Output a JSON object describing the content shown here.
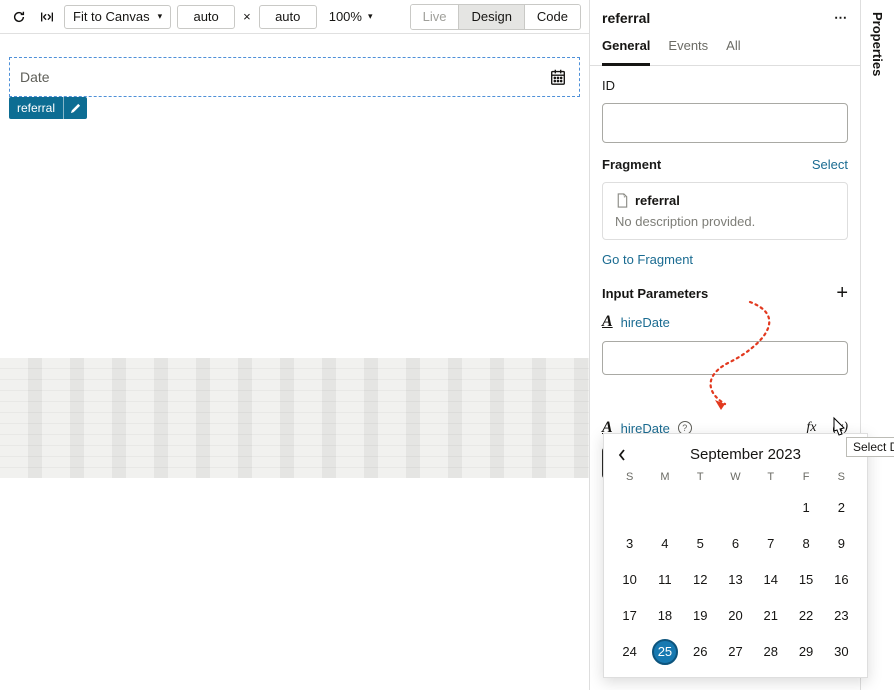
{
  "toolbar": {
    "fit_label": "Fit to Canvas",
    "width": "auto",
    "height": "auto",
    "zoom": "100%",
    "live": "Live",
    "design": "Design",
    "code": "Code"
  },
  "canvas": {
    "placeholder": "Date",
    "badge": "referral"
  },
  "panel": {
    "title": "referral",
    "tabs": {
      "general": "General",
      "events": "Events",
      "all": "All"
    },
    "id_label": "ID",
    "id_value": "",
    "fragment_label": "Fragment",
    "select_link": "Select",
    "fragment_name": "referral",
    "fragment_desc": "No description provided.",
    "go_link": "Go to Fragment",
    "input_params_label": "Input Parameters",
    "param1": "hireDate",
    "param1_value": "",
    "param2": "hireDate",
    "fx_label": "fx",
    "x_var": "(x)",
    "date_placeholder": "Select a date",
    "vertical_tab": "Properties"
  },
  "calendar": {
    "month_label": "September 2023",
    "dow": [
      "S",
      "M",
      "T",
      "W",
      "T",
      "F",
      "S"
    ],
    "leading_blanks": 5,
    "days": 30,
    "today": 25
  },
  "tooltip": "Select Da"
}
